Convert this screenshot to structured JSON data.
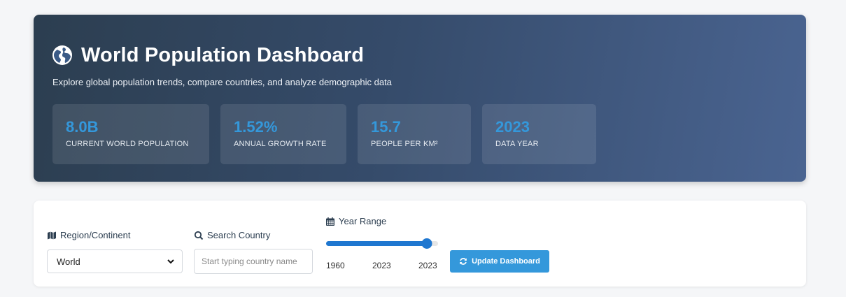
{
  "header": {
    "title": "World Population Dashboard",
    "subtitle": "Explore global population trends, compare countries, and analyze demographic data",
    "icon": "globe-icon",
    "stats": [
      {
        "value": "8.0B",
        "label": "CURRENT WORLD POPULATION"
      },
      {
        "value": "1.52%",
        "label": "ANNUAL GROWTH RATE"
      },
      {
        "value": "15.7",
        "label": "PEOPLE PER KM²"
      },
      {
        "value": "2023",
        "label": "DATA YEAR"
      }
    ]
  },
  "controls": {
    "region": {
      "label": "Region/Continent",
      "icon": "map-icon",
      "selected": "World"
    },
    "search": {
      "label": "Search Country",
      "icon": "search-icon",
      "placeholder": "Start typing country name"
    },
    "year_range": {
      "label": "Year Range",
      "icon": "calendar-icon",
      "min": "1960",
      "current": "2023",
      "max": "2023",
      "fill_fraction": 0.9
    },
    "update_button": {
      "label": "Update Dashboard",
      "icon": "refresh-icon"
    }
  },
  "colors": {
    "accent": "#3498db",
    "header_dark": "#2c3e50",
    "slider": "#1f77d0"
  }
}
